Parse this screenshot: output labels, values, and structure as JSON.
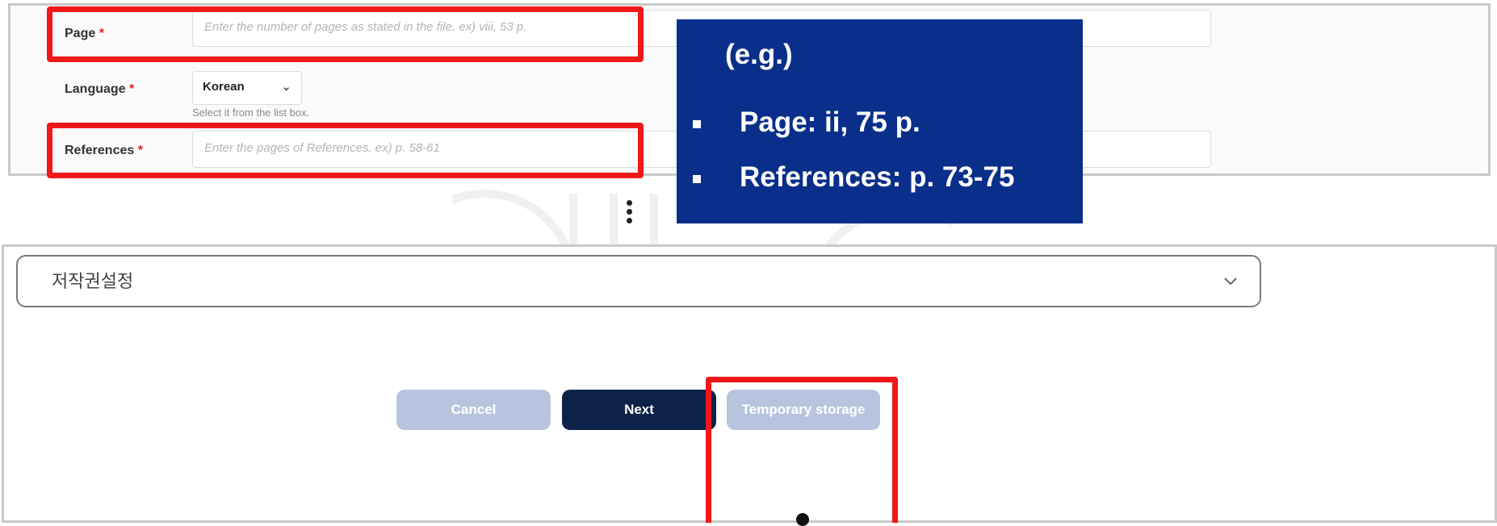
{
  "form": {
    "page": {
      "label": "Page",
      "required_mark": "*",
      "placeholder": "Enter the number of pages as stated in the file. ex) viii, 53 p."
    },
    "language": {
      "label": "Language",
      "required_mark": "*",
      "selected": "Korean",
      "help": "Select it from the list box."
    },
    "references": {
      "label": "References",
      "required_mark": "*",
      "placeholder": "Enter the pages of References. ex) p. 58-61"
    }
  },
  "callout": {
    "title": "(e.g.)",
    "items": [
      {
        "text": "Page: ii, 75 p."
      },
      {
        "text": "References: p. 73-75"
      }
    ]
  },
  "copyright_section": {
    "title": "저작권설정",
    "icon": "chevron-down-icon"
  },
  "buttons": {
    "cancel": "Cancel",
    "next": "Next",
    "temporary_storage": "Temporary storage"
  },
  "colors": {
    "highlight": "#f01818",
    "callout_bg": "#0a2f8a",
    "primary_button": "#0d2248",
    "disabled_button": "#b8c4de",
    "required": "#e0202a"
  }
}
